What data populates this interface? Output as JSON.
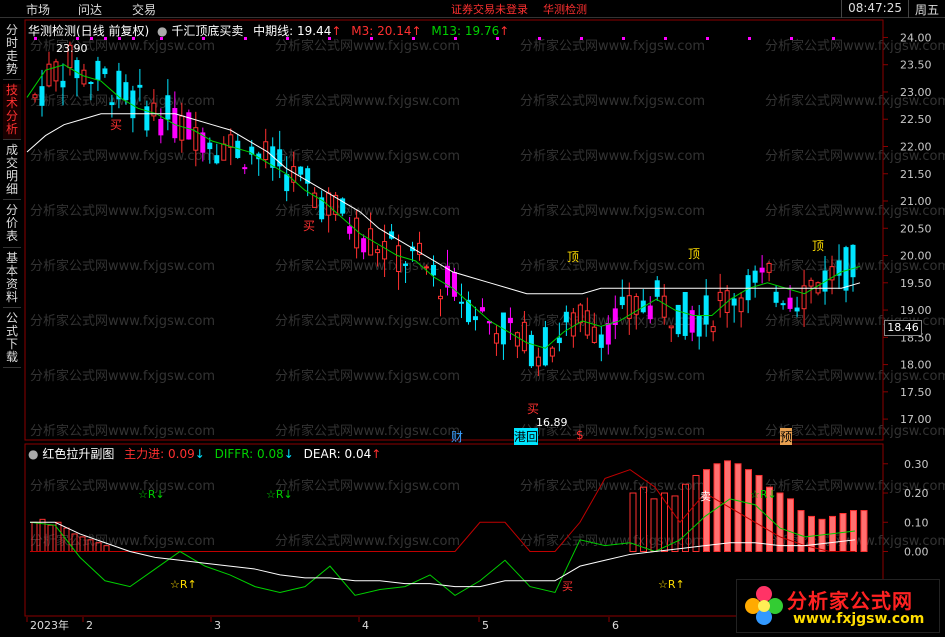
{
  "topbar": {
    "menus": [
      "市场",
      "问达",
      "交易"
    ],
    "warning_login": "证券交易未登录",
    "app_name": "华测检测",
    "time": "08:47:25",
    "weekday": "周五"
  },
  "sidebar": {
    "tabs": [
      {
        "label": "分时走势",
        "active": false
      },
      {
        "label": "技术分析",
        "active": true
      },
      {
        "label": "成交明细",
        "active": false
      },
      {
        "label": "分价表",
        "active": false
      },
      {
        "label": "基本资料",
        "active": false
      },
      {
        "label": "公式下载",
        "active": false
      }
    ]
  },
  "main_chart": {
    "title": "华测检测(日线 前复权)",
    "indicator": "千汇顶底买卖",
    "mid_label": "中期线: 19.44",
    "m3_label": "M3: 20.14",
    "m13_label": "M13: 19.76",
    "high_mark": "23.90",
    "low_mark": "16.89",
    "last_price": "18.46",
    "y_ticks": [
      "24.00",
      "23.50",
      "23.00",
      "22.50",
      "22.00",
      "21.50",
      "21.00",
      "20.50",
      "20.00",
      "19.50",
      "19.00",
      "18.50",
      "18.00",
      "17.50",
      "17.00"
    ],
    "y_range": [
      16.8,
      24.1
    ],
    "signals": {
      "buy": "买",
      "top": "顶"
    },
    "event_tags": [
      "财",
      "港回",
      "$",
      "预"
    ],
    "watermark": "分析家公式网www.fxjgsw.com",
    "colors": {
      "up": "#ff3030",
      "down": "#00e5ff",
      "limit": "#ff00ff",
      "m3": "#00d000",
      "mid": "#ffffff"
    }
  },
  "sub_chart": {
    "title": "红色拉升副图",
    "zhuli_label": "主力进: 0.09",
    "diffr_label": "DIFFR: 0.08",
    "dear_label": "DEAR: 0.04",
    "y_ticks": [
      "0.30",
      "0.20",
      "0.10",
      "0.00"
    ],
    "y_range": [
      -0.2,
      0.33
    ],
    "tags": {
      "r_down": "☆R↓",
      "r_up": "☆R↑",
      "buy": "买",
      "sell_tag": "卖"
    },
    "x_labels": [
      "2023年",
      "2",
      "3",
      "4",
      "5",
      "6"
    ]
  },
  "logo": {
    "text": "分析家公式网",
    "url": "www.fxjgsw.com"
  },
  "chart_data": {
    "type": "line",
    "title": "华测检测(日线 前复权)",
    "xlabel": "",
    "ylabel": "",
    "ylim": [
      16.8,
      24.1
    ],
    "x_labels": [
      "2023年",
      "2",
      "3",
      "4",
      "5",
      "6"
    ],
    "series": [
      {
        "name": "M3",
        "values": [
          22.9,
          23.4,
          23.5,
          23.3,
          23.2,
          22.9,
          22.7,
          22.6,
          22.4,
          22.3,
          22.1,
          22.0,
          21.9,
          21.7,
          21.5,
          21.2,
          21.0,
          20.7,
          20.4,
          20.2,
          20.0,
          19.9,
          19.6,
          19.4,
          19.1,
          18.8,
          18.6,
          18.4,
          18.3,
          18.6,
          18.8,
          18.7,
          18.8,
          19.0,
          19.2,
          19.0,
          18.9,
          18.9,
          19.2,
          19.4,
          19.5,
          19.4,
          19.3,
          19.5,
          19.7,
          19.8
        ]
      },
      {
        "name": "中期线",
        "values": [
          21.9,
          22.2,
          22.4,
          22.5,
          22.6,
          22.6,
          22.6,
          22.6,
          22.6,
          22.5,
          22.4,
          22.3,
          22.1,
          21.9,
          21.6,
          21.4,
          21.2,
          21.0,
          20.8,
          20.5,
          20.3,
          20.1,
          19.9,
          19.7,
          19.6,
          19.5,
          19.4,
          19.3,
          19.3,
          19.3,
          19.3,
          19.4,
          19.4,
          19.4,
          19.4,
          19.4,
          19.4,
          19.4,
          19.4,
          19.4,
          19.4,
          19.4,
          19.4,
          19.4,
          19.4,
          19.5
        ]
      }
    ],
    "annotations": [
      "23.90",
      "16.89"
    ]
  }
}
